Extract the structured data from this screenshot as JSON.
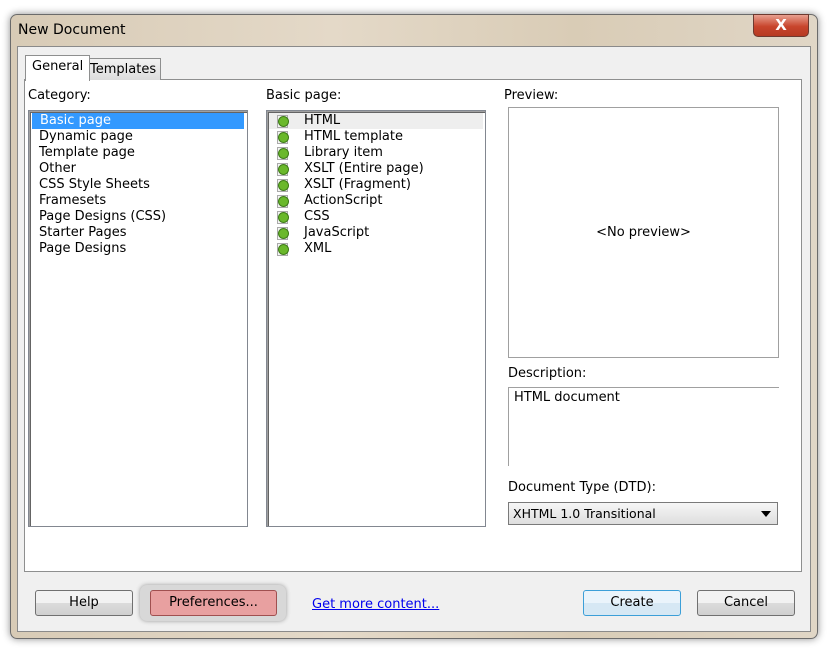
{
  "window": {
    "title": "New Document",
    "close_label": "X"
  },
  "tabs": [
    {
      "label": "General"
    },
    {
      "label": "Templates"
    }
  ],
  "category": {
    "label": "Category:",
    "items": [
      "Basic page",
      "Dynamic page",
      "Template page",
      "Other",
      "CSS Style Sheets",
      "Framesets",
      "Page Designs (CSS)",
      "Starter Pages",
      "Page Designs"
    ],
    "selected": "Basic page"
  },
  "basic_page": {
    "label": "Basic page:",
    "items": [
      "HTML",
      "HTML template",
      "Library item",
      "XSLT (Entire page)",
      "XSLT (Fragment)",
      "ActionScript",
      "CSS",
      "JavaScript",
      "XML"
    ],
    "icon": "document-icon"
  },
  "preview": {
    "label": "Preview:",
    "text": "<No preview>"
  },
  "description": {
    "label": "Description:",
    "text": "HTML document"
  },
  "doctype": {
    "label": "Document Type (DTD):",
    "value": "XHTML 1.0 Transitional"
  },
  "buttons": {
    "help": "Help",
    "preferences": "Preferences...",
    "more": "Get more content...",
    "create": "Create",
    "cancel": "Cancel"
  },
  "colors": {
    "selection": "#3399ff",
    "link": "#0000ee",
    "preferences_highlight": "#e8a0a0"
  }
}
